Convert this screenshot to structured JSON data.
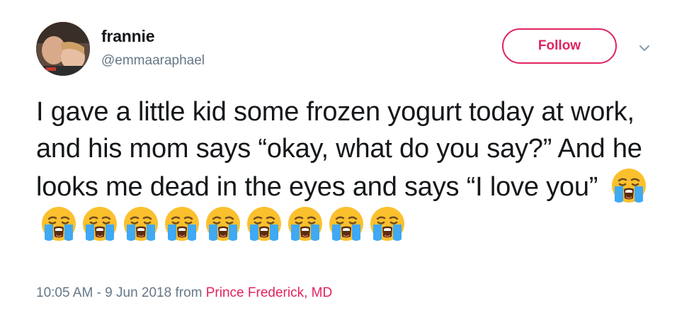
{
  "user": {
    "display_name": "frannie",
    "handle": "@emmaaraphael"
  },
  "actions": {
    "follow_label": "Follow"
  },
  "tweet": {
    "text": "I gave a little kid some frozen yogurt today at work, and his mom says “okay, what do you say?” And he looks me dead in the eyes and says “I love you”",
    "emoji_name": "loudly-crying-face",
    "emoji_count": 10
  },
  "meta": {
    "timestamp": "10:05 AM - 9 Jun 2018",
    "from_label": "from",
    "location": "Prince Frederick, MD"
  },
  "colors": {
    "accent": "#e0245e",
    "text": "#14171a",
    "secondary": "#657786",
    "emoji_face": "#fbc02d",
    "emoji_tears": "#3fa9f5"
  }
}
